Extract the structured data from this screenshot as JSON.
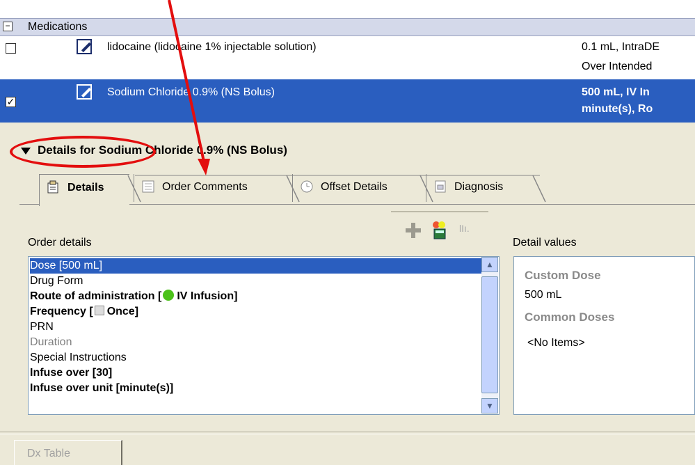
{
  "top_strip": {
    "cut_text": "··· ·· ···"
  },
  "medications": {
    "header_title": "Medications",
    "rows": [
      {
        "name": "lidocaine (lidocaine 1% injectable solution)",
        "detail_line1": "0.1 mL, IntraDE",
        "detail_line2": "Over Intended",
        "checked": false
      },
      {
        "name": "Sodium Chloride 0.9% (NS Bolus)",
        "detail_line1": "500 mL, IV In",
        "detail_line2": "minute(s), Ro",
        "checked": true
      }
    ]
  },
  "details": {
    "title": "Details for Sodium Chloride 0.9% (NS Bolus)",
    "tabs": [
      {
        "label": "Details",
        "icon": "details-icon",
        "active": true
      },
      {
        "label": "Order Comments",
        "icon": "comments-icon",
        "active": false
      },
      {
        "label": "Offset Details",
        "icon": "clock-icon",
        "active": false
      },
      {
        "label": "Diagnosis",
        "icon": "diagnosis-icon",
        "active": false
      }
    ],
    "order_details_label": "Order details",
    "detail_values_label": "Detail values",
    "order_items": [
      {
        "text": "Dose  [500 mL]",
        "style": "selected"
      },
      {
        "text": "Drug Form",
        "style": "normal"
      },
      {
        "prefix": "Route of administration   [",
        "value": "IV Infusion]",
        "style": "bold",
        "icon": "green-dot"
      },
      {
        "prefix": "Frequency   [",
        "value": "Once]",
        "style": "bold",
        "icon": "gray-square"
      },
      {
        "text": "PRN",
        "style": "normal"
      },
      {
        "text": "Duration",
        "style": "gray"
      },
      {
        "text": "Special Instructions",
        "style": "normal"
      },
      {
        "text": "Infuse over   [30]",
        "style": "bold"
      },
      {
        "text": "Infuse over unit   [minute(s)]",
        "style": "bold"
      }
    ],
    "values": {
      "custom_dose_label": "Custom Dose",
      "custom_dose_value": "500 mL",
      "common_doses_label": "Common Doses",
      "no_items": "<No Items>"
    }
  },
  "bottom": {
    "dx_table_button": "Dx Table"
  },
  "colors": {
    "selection": "#2a5ebf",
    "annotation": "#e30e0e",
    "panel": "#ece9d8"
  }
}
